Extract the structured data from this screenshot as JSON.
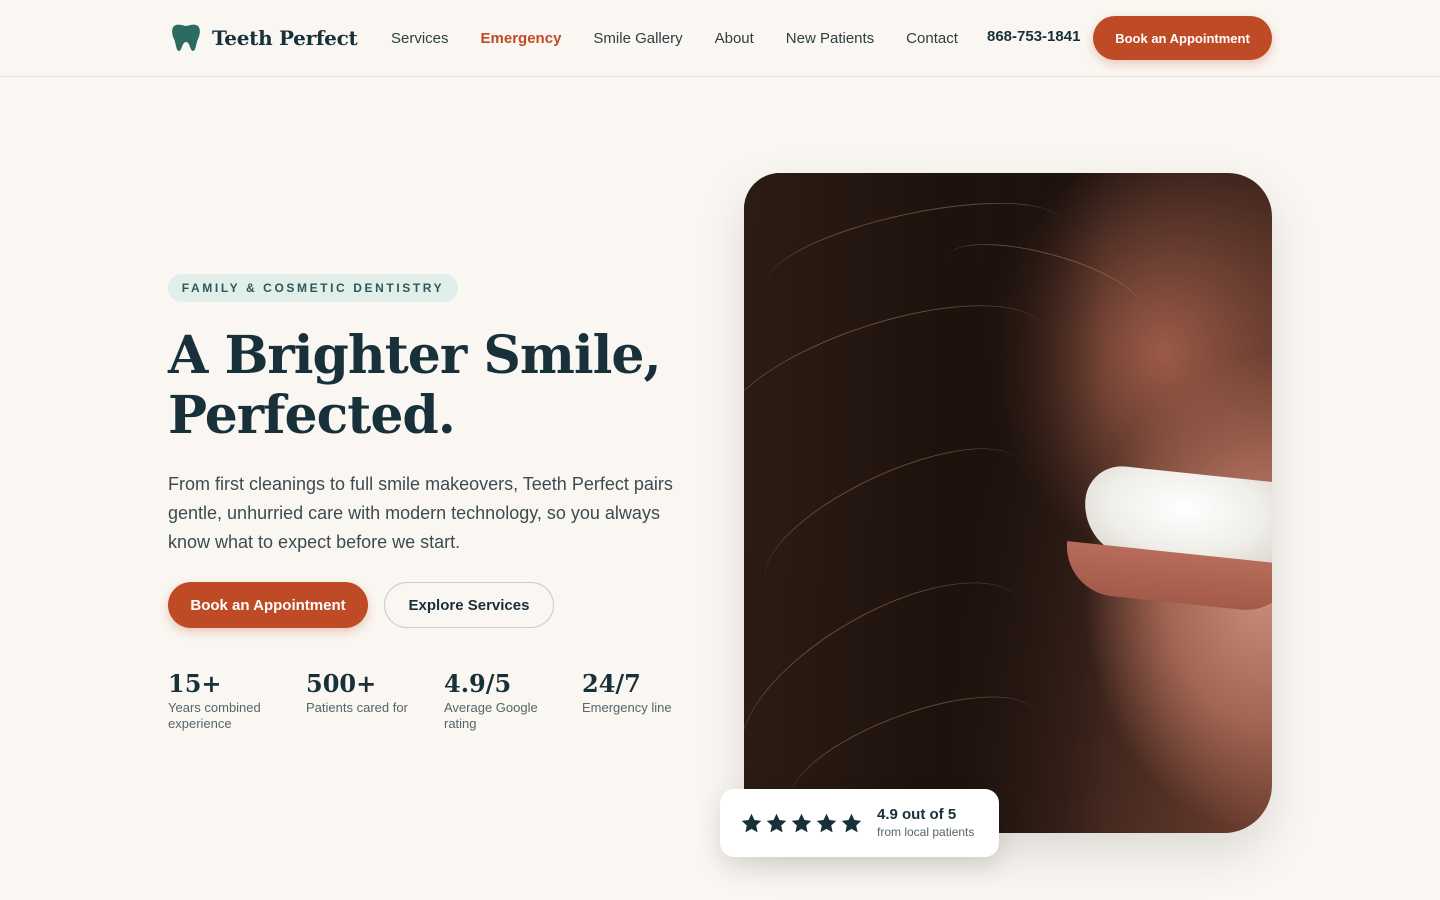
{
  "brand": {
    "name": "Teeth Perfect",
    "logo_icon": "tooth-icon",
    "logo_color": "#2c6b62"
  },
  "nav": {
    "items": [
      {
        "label": "Services"
      },
      {
        "label": "Emergency"
      },
      {
        "label": "Smile Gallery"
      },
      {
        "label": "About"
      },
      {
        "label": "New Patients"
      },
      {
        "label": "Contact"
      }
    ],
    "active": "Emergency",
    "phone": "868-753-1841",
    "cta_label": "Book an Appointment"
  },
  "hero": {
    "badge": "FAMILY & COSMETIC DENTISTRY",
    "headline_line1": "A Brighter Smile,",
    "headline_line2": "Perfected.",
    "lead": "From first cleanings to full smile makeovers, Teeth Perfect pairs gentle, unhurried care with modern technology, so you always know what to expect before we start.",
    "primary_cta": "Book an Appointment",
    "secondary_cta": "Explore Services",
    "image_subject": "smiling woman with flowing hair"
  },
  "stats": [
    {
      "value": "15+",
      "label": "Years combined experience"
    },
    {
      "value": "500+",
      "label": "Patients cared for"
    },
    {
      "value": "4.9/5",
      "label": "Average Google rating"
    },
    {
      "value": "24/7",
      "label": "Emergency line"
    }
  ],
  "rating": {
    "stars": 5,
    "score": "4.9 out of 5",
    "source": "from local patients",
    "icon": "star-icon"
  },
  "colors": {
    "accent": "#bf4b26",
    "ink": "#17303a",
    "background": "#faf7f2",
    "badge_bg": "#e1eeeb"
  }
}
